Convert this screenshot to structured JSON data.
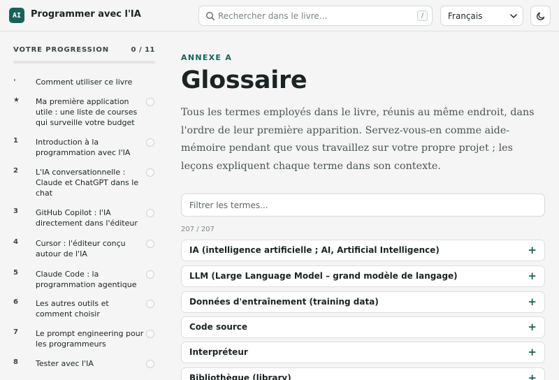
{
  "header": {
    "logo_text": "AI",
    "title": "Programmer avec l'IA",
    "search_placeholder": "Rechercher dans le livre...",
    "search_shortcut": "/",
    "language": "Français",
    "icons": {
      "search": "search-icon",
      "theme": "moon-icon",
      "language": "chevron-down-icon"
    }
  },
  "sidebar": {
    "progress_label": "VOTRE PROGRESSION",
    "progress_count": "0 / 11",
    "progress_fraction": 0,
    "items": [
      {
        "num": "·",
        "label": "Comment utiliser ce livre",
        "has_check": false
      },
      {
        "num": "★",
        "label": "Ma première application utile : une liste de courses qui surveille votre budget",
        "has_check": true
      },
      {
        "num": "1",
        "label": "Introduction à la programmation avec l'IA",
        "has_check": true
      },
      {
        "num": "2",
        "label": "L'IA conversationnelle : Claude et ChatGPT dans le chat",
        "has_check": true
      },
      {
        "num": "3",
        "label": "GitHub Copilot : l'IA directement dans l'éditeur",
        "has_check": true
      },
      {
        "num": "4",
        "label": "Cursor : l'éditeur conçu autour de l'IA",
        "has_check": true
      },
      {
        "num": "5",
        "label": "Claude Code : la programmation agentique",
        "has_check": true
      },
      {
        "num": "6",
        "label": "Les autres outils et comment choisir",
        "has_check": true
      },
      {
        "num": "7",
        "label": "Le prompt engineering pour les programmeurs",
        "has_check": true
      },
      {
        "num": "8",
        "label": "Tester avec l'IA",
        "has_check": true
      }
    ]
  },
  "main": {
    "eyebrow": "ANNEXE A",
    "title": "Glossaire",
    "intro": "Tous les termes employés dans le livre, réunis au même endroit, dans l'ordre de leur première apparition. Servez-vous-en comme aide-mémoire pendant que vous travaillez sur votre propre projet ; les leçons expliquent chaque terme dans son contexte.",
    "filter_placeholder": "Filtrer les termes...",
    "count": "207 / 207",
    "expand_symbol": "+",
    "terms": [
      "IA (intelligence artificielle ; AI, Artificial Intelligence)",
      "LLM (Large Language Model – grand modèle de langage)",
      "Données d'entraînement (training data)",
      "Code source",
      "Interpréteur",
      "Bibliothèque (library)"
    ]
  },
  "colors": {
    "accent": "#17625a",
    "background": "#f4f5f4",
    "text": "#1b2424"
  }
}
